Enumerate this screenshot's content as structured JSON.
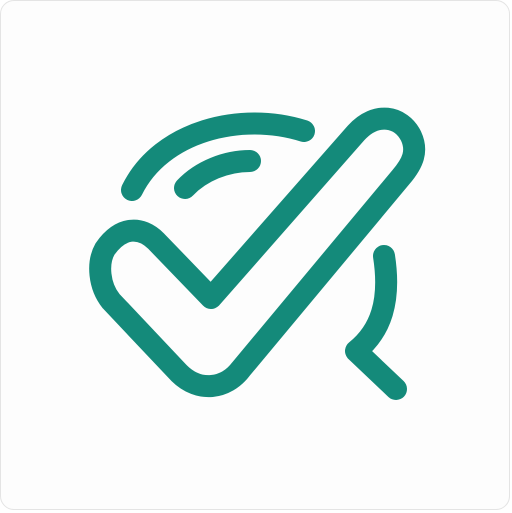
{
  "icon": {
    "name": "check-loop-logo",
    "color": "#148a7a",
    "background": "#fdfdfd",
    "border": "#e4e4e4"
  }
}
